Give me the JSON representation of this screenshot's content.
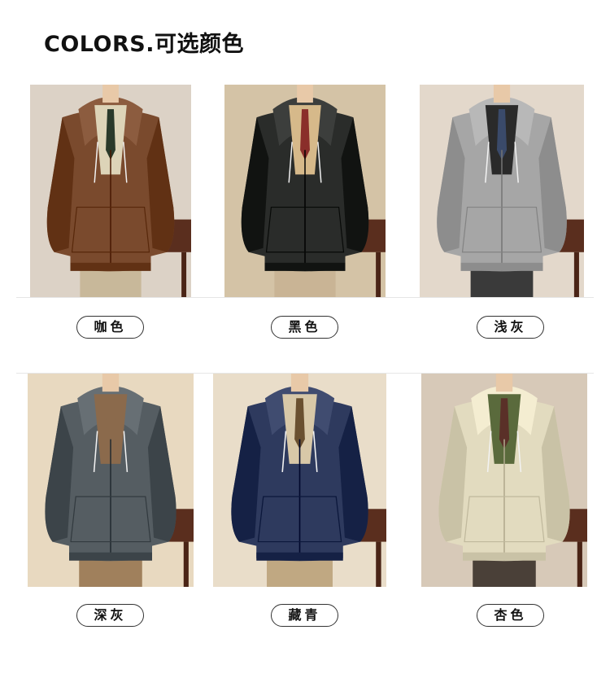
{
  "header": {
    "title": "COLORS.可选颜色"
  },
  "products": [
    {
      "label": "咖色",
      "hoodie_color": "#7a4a2d",
      "inner_color": "#ddd4b8",
      "tie_color": "#2a3a2a",
      "pants_color": "#c8b89a",
      "bg_color": "#dcd2c6"
    },
    {
      "label": "黑色",
      "hoodie_color": "#2a2c2a",
      "inner_color": "#d6b98a",
      "tie_color": "#8a2e2a",
      "pants_color": "#c9b495",
      "bg_color": "#d4c3a6"
    },
    {
      "label": "浅灰",
      "hoodie_color": "#a6a6a6",
      "inner_color": "#2a2a2a",
      "tie_color": "#3a4a6a",
      "pants_color": "#3a3a3a",
      "bg_color": "#e3d8cb"
    },
    {
      "label": "深灰",
      "hoodie_color": "#555d62",
      "inner_color": "#8b6a4c",
      "tie_color": "#8b6a4c",
      "pants_color": "#a0805c",
      "bg_color": "#e8d9c0"
    },
    {
      "label": "藏青",
      "hoodie_color": "#2e3a5e",
      "inner_color": "#d8c8a8",
      "tie_color": "#6a5030",
      "pants_color": "#c0a882",
      "bg_color": "#e9ddc9"
    },
    {
      "label": "杏色",
      "hoodie_color": "#e2dbbf",
      "inner_color": "#5a6a3c",
      "tie_color": "#5a3028",
      "pants_color": "#4a4038",
      "bg_color": "#d7c9b8"
    }
  ]
}
